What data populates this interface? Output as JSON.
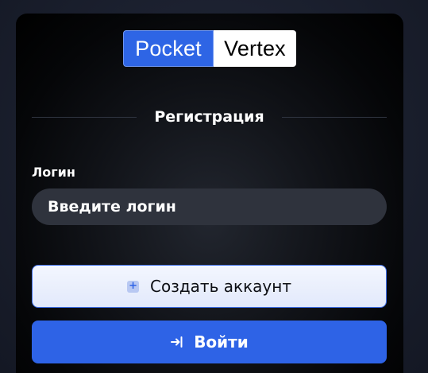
{
  "logo": {
    "part1": "Pocket",
    "part2": "Vertex"
  },
  "form": {
    "title": "Регистрация",
    "login_label": "Логин",
    "login_placeholder": "Введите логин",
    "login_value": "",
    "create_account_label": "Создать аккаунт",
    "login_button_label": "Войти"
  },
  "icons": {
    "create": "plus-square-icon",
    "login": "sign-in-arrow-icon"
  },
  "colors": {
    "accent": "#2e63e6",
    "logo_blue": "#2e65e5",
    "create_button_bg": "#e8eefc",
    "input_bg": "#2f333d",
    "card_bg": "#000000"
  }
}
